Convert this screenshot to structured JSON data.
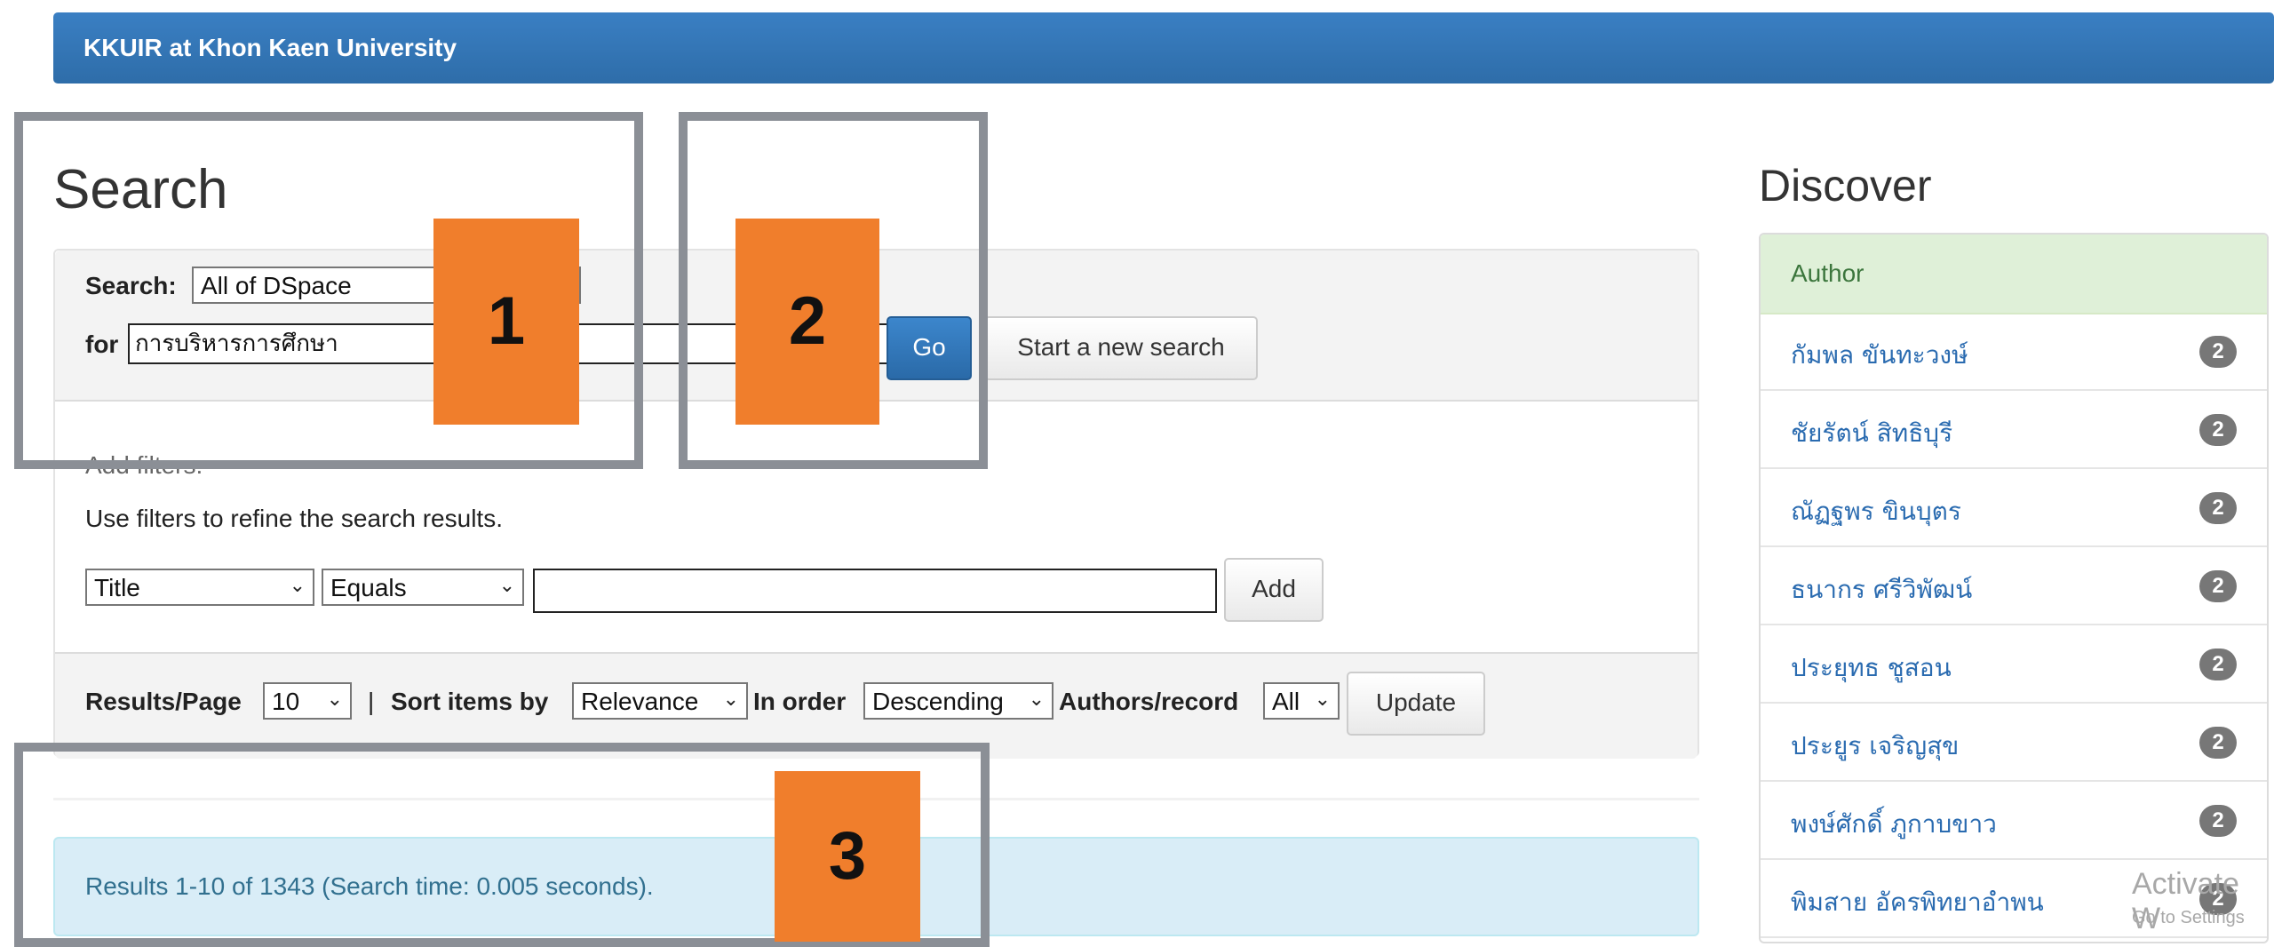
{
  "header": {
    "brand": "KKUIR at Khon Kaen University"
  },
  "search": {
    "page_title": "Search",
    "scope_label": "Search:",
    "scope_value": "All of DSpace",
    "for_label": "for",
    "query_value": "การบริหารการศึกษา",
    "go_label": "Go",
    "new_search_label": "Start a new search"
  },
  "filters": {
    "add_heading": "Add filters:",
    "hint": "Use filters to refine the search results.",
    "field_value": "Title",
    "op_value": "Equals",
    "text_value": "",
    "add_label": "Add"
  },
  "options": {
    "results_per_page_label": "Results/Page",
    "results_per_page_value": "10",
    "divider": "|",
    "sort_label": "Sort items by",
    "sort_value": "Relevance",
    "order_label": "In order",
    "order_value": "Descending",
    "authors_label": "Authors/record",
    "authors_value": "All",
    "update_label": "Update"
  },
  "results": {
    "summary": "Results 1-10 of 1343 (Search time: 0.005 seconds)."
  },
  "discover": {
    "title": "Discover",
    "facet_heading": "Author",
    "authors": [
      {
        "name": "กัมพล ขันทะวงษ์",
        "count": "2"
      },
      {
        "name": "ชัยรัตน์ สิทธิบุรี",
        "count": "2"
      },
      {
        "name": "ณัฏฐพร ขินบุตร",
        "count": "2"
      },
      {
        "name": "ธนากร ศรีวิพัฒน์",
        "count": "2"
      },
      {
        "name": "ประยุทธ ชูสอน",
        "count": "2"
      },
      {
        "name": "ประยูร เจริญสุข",
        "count": "2"
      },
      {
        "name": "พงษ์ศักดิ์ ภูกาบขาว",
        "count": "2"
      },
      {
        "name": "พิมสาย อัครพิทยาอำพน",
        "count": "2"
      }
    ]
  },
  "annotations": {
    "marker_1": "1",
    "marker_2": "2",
    "marker_3": "3"
  },
  "watermark": {
    "line1": "Activate W",
    "line2": "Go to Settings"
  },
  "colors": {
    "navbar": "#2e6da9",
    "primary_button": "#337ab7",
    "facet_header_bg": "#dff0d8",
    "info_alert_bg": "#d9edf7",
    "link": "#2a6bb0",
    "annotation_marker": "#f07e2c",
    "annotation_box": "#8b8f96"
  }
}
